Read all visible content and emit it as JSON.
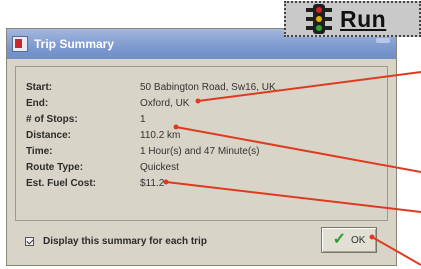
{
  "toolbar": {
    "run_label": "Run",
    "run_icon": "traffic-light-icon"
  },
  "dialog": {
    "title": "Trip Summary",
    "fields": [
      {
        "label": "Start:",
        "value": "50 Babington Road, Sw16, UK"
      },
      {
        "label": "End:",
        "value": "Oxford, UK"
      },
      {
        "label": "# of Stops:",
        "value": "1"
      },
      {
        "label": "Distance:",
        "value": "110.2 km"
      },
      {
        "label": "Time:",
        "value": "1 Hour(s) and 47 Minute(s)"
      },
      {
        "label": "Route Type:",
        "value": "Quickest"
      },
      {
        "label": "Est. Fuel Cost:",
        "value": "$11.2"
      }
    ],
    "display_summary_label": "Display this summary for each trip",
    "display_summary_checked": true,
    "ok_label": "OK"
  },
  "colors": {
    "callout": "#e03a1e",
    "titlebar": "#7f9bd0",
    "dialog_bg": "#d8d4c8",
    "ok_check": "#2f9a35"
  }
}
